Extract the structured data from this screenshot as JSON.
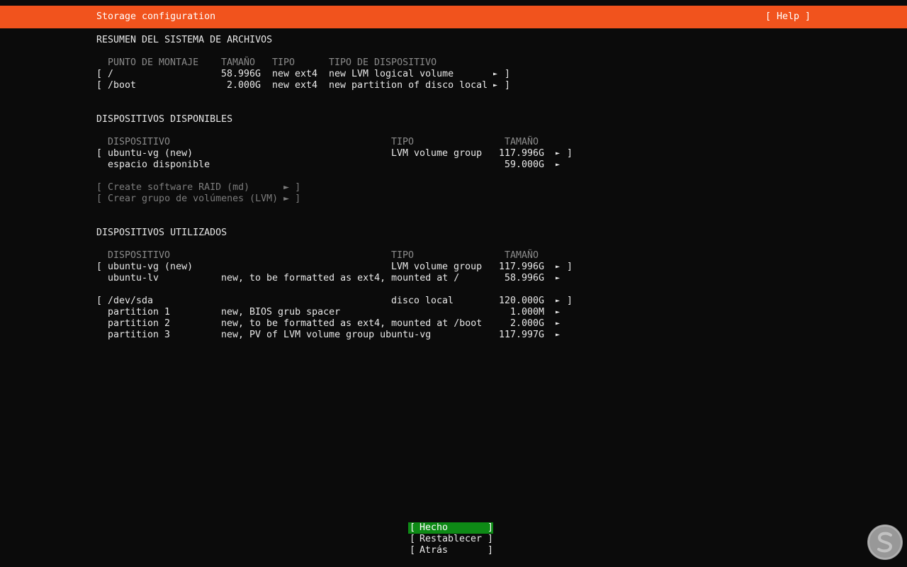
{
  "header": {
    "title": "Storage configuration",
    "help": "[ Help ]"
  },
  "fs_summary": {
    "title": "RESUMEN DEL SISTEMA DE ARCHIVOS",
    "columns": [
      "PUNTO DE MONTAJE",
      "TAMAÑO",
      "TIPO",
      "TIPO DE DISPOSITIVO"
    ],
    "rows": [
      {
        "bracket_open": "[",
        "mount": "/",
        "size": "58.996G",
        "type": "new ext4",
        "device_type": "new LVM logical volume",
        "arrow": "►",
        "bracket_close": "]"
      },
      {
        "bracket_open": "[",
        "mount": "/boot",
        "size": "2.000G",
        "type": "new ext4",
        "device_type": "new partition of disco local",
        "arrow": "►",
        "bracket_close": "]"
      }
    ]
  },
  "available": {
    "title": "DISPOSITIVOS DISPONIBLES",
    "columns": [
      "DISPOSITIVO",
      "TIPO",
      "TAMAÑO"
    ],
    "rows": [
      {
        "bracket_open": "[",
        "device": "ubuntu-vg (new)",
        "type": "LVM volume group",
        "size": "117.996G",
        "arrow": "►",
        "bracket_close": "]"
      },
      {
        "device": "espacio disponible",
        "size": "59.000G",
        "arrow": "►"
      }
    ],
    "actions": [
      {
        "label": "[ Create software RAID (md)      ► ]"
      },
      {
        "label": "[ Crear grupo de volúmenes (LVM) ► ]"
      }
    ]
  },
  "used": {
    "title": "DISPOSITIVOS UTILIZADOS",
    "columns": [
      "DISPOSITIVO",
      "TIPO",
      "TAMAÑO"
    ],
    "groups": [
      {
        "bracket_open": "[",
        "device": "ubuntu-vg (new)",
        "type": "LVM volume group",
        "size": "117.996G",
        "arrow": "►",
        "bracket_close": "]",
        "children": [
          {
            "device": "ubuntu-lv",
            "desc": "new, to be formatted as ext4, mounted at /",
            "size": "58.996G",
            "arrow": "►"
          }
        ]
      },
      {
        "bracket_open": "[",
        "device": "/dev/sda",
        "type": "disco local",
        "size": "120.000G",
        "arrow": "►",
        "bracket_close": "]",
        "children": [
          {
            "device": "partition 1",
            "desc": "new, BIOS grub spacer",
            "size": "1.000M",
            "arrow": "►"
          },
          {
            "device": "partition 2",
            "desc": "new, to be formatted as ext4, mounted at /boot",
            "size": "2.000G",
            "arrow": "►"
          },
          {
            "device": "partition 3",
            "desc": "new, PV of LVM volume group ubuntu-vg",
            "size": "117.997G",
            "arrow": "►"
          }
        ]
      }
    ]
  },
  "buttons": {
    "open": "[",
    "close": "]",
    "done": "Hecho",
    "reset": "Restablecer",
    "back": "Atrás"
  },
  "colors": {
    "header_bg": "#f1531d",
    "active_button_bg": "#0e8a16",
    "background": "#0b0b0b"
  }
}
